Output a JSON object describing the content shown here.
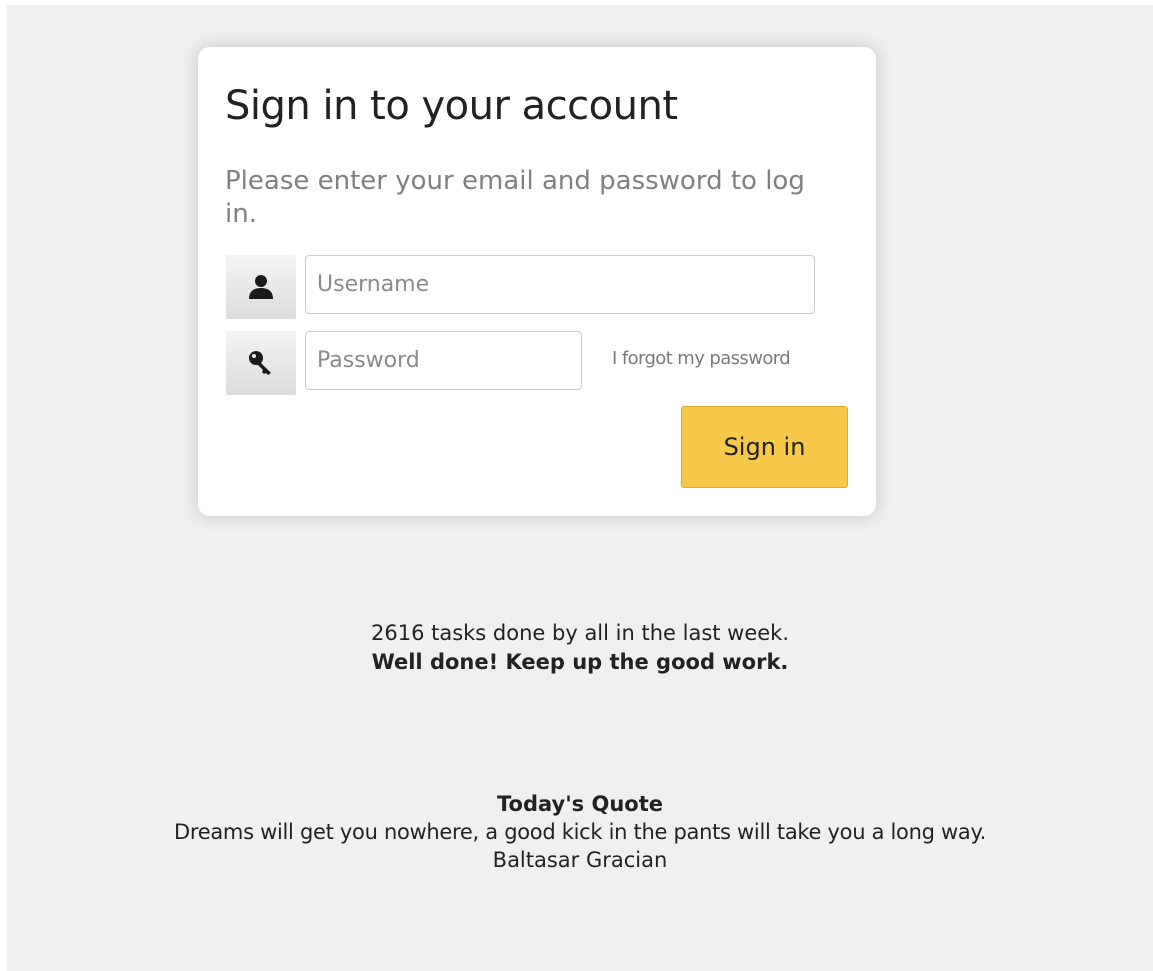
{
  "login": {
    "title": "Sign in to your account",
    "subtitle": "Please enter your email and password to log in.",
    "username": {
      "placeholder": "Username",
      "value": "",
      "icon": "user-icon"
    },
    "password": {
      "placeholder": "Password",
      "value": "",
      "icon": "key-icon"
    },
    "forgot_label": "I forgot my password",
    "submit_label": "Sign in",
    "accent_color": "#f7c948"
  },
  "stats": {
    "tasks_line": "2616 tasks done by all in the last week.",
    "encouragement": "Well done! Keep up the good work."
  },
  "quote": {
    "heading": "Today's Quote",
    "text": "Dreams will get you nowhere, a good kick in the pants will take you a long way.",
    "author": "Baltasar Gracian"
  }
}
